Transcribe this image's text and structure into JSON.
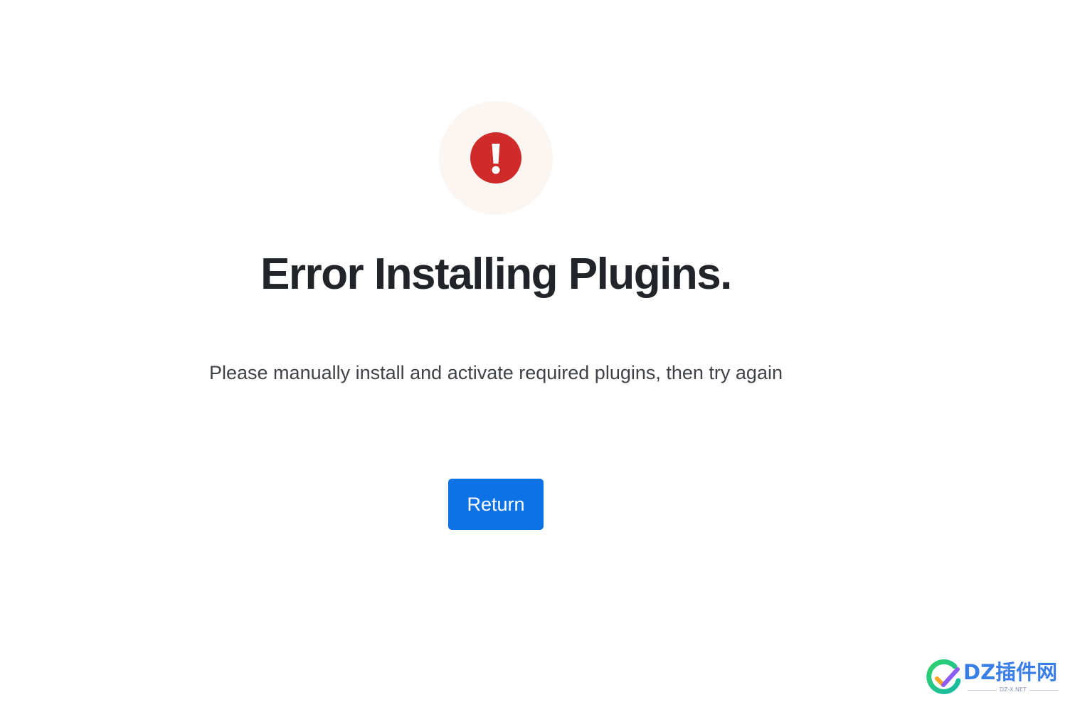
{
  "error": {
    "icon": "exclamation-circle-icon",
    "icon_color": "#cf2b2b",
    "halo_color": "#fcf6f3",
    "title": "Error Installing Plugins.",
    "message": "Please manually install and activate required plugins, then try again"
  },
  "actions": {
    "return_label": "Return",
    "return_color": "#0d72e6"
  },
  "watermark": {
    "text": "DZ插件网",
    "subtext": "DZ-X.NET"
  }
}
